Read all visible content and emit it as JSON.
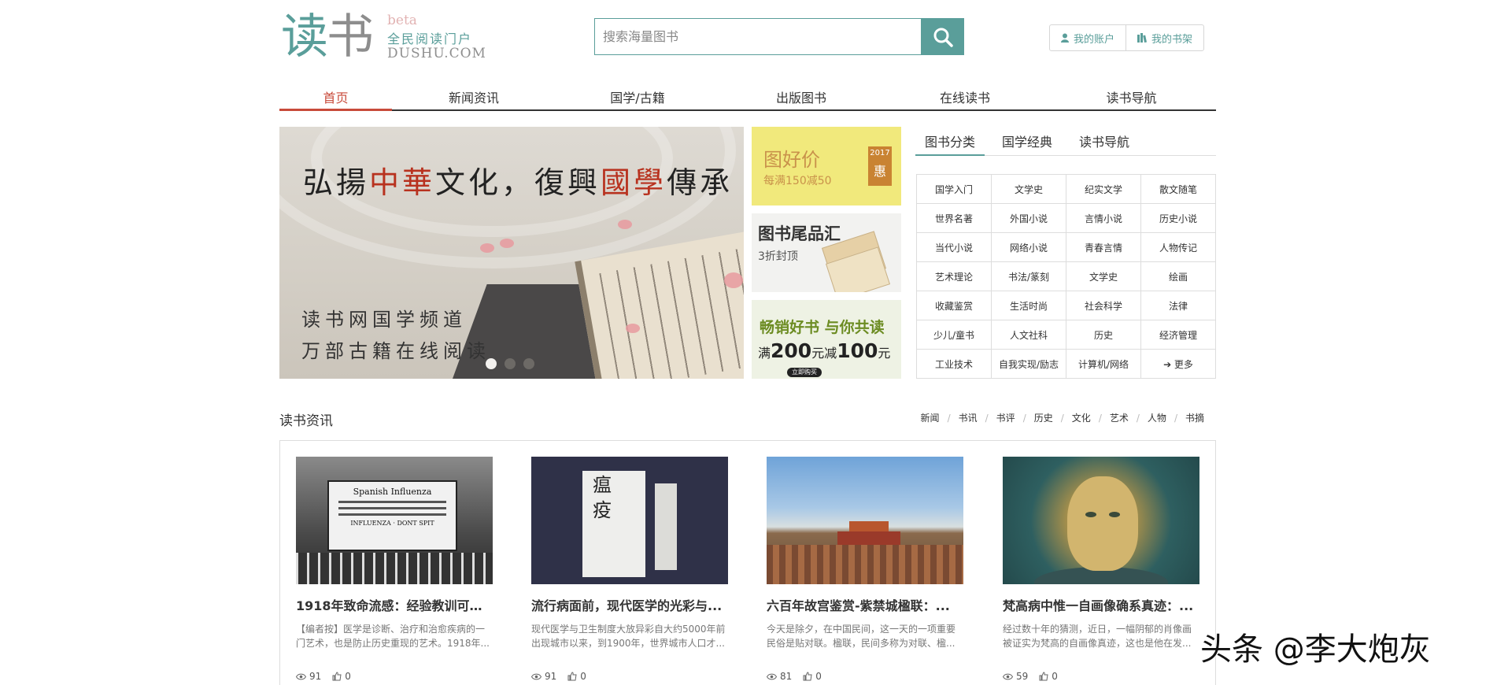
{
  "header": {
    "logo_cn_1": "读",
    "logo_cn_2": "书",
    "logo_beta": "beta",
    "logo_slogan": "全民阅读门户",
    "logo_en": "DUSHU.COM",
    "search_placeholder": "搜索海量图书",
    "account_label": "我的账户",
    "shelf_label": "我的书架"
  },
  "nav": {
    "items": [
      "首页",
      "新闻资讯",
      "国学/古籍",
      "出版图书",
      "在线读书",
      "读书导航"
    ],
    "active": "首页"
  },
  "banner": {
    "title_1": "弘揚",
    "title_2": "中華",
    "title_3": "文化，復興",
    "title_4": "國學",
    "title_5": "傳承",
    "sub_1": "读书网国学频道",
    "sub_2": "万部古籍在线阅读",
    "glyphs": "瘟疫"
  },
  "promos": {
    "p1_title": "图好价",
    "p1_sub": "每满150减50",
    "p1_year": "2017",
    "p1_tag": "惠",
    "p2_title": "图书尾品汇",
    "p2_sub": "3折封顶",
    "p3_title": "畅销好书 与你共读",
    "p3_sub_a": "满",
    "p3_sub_b": "200",
    "p3_sub_c": "元减",
    "p3_sub_d": "100",
    "p3_sub_e": "元",
    "p3_btn": "立即购买"
  },
  "category": {
    "tabs": [
      "图书分类",
      "国学经典",
      "读书导航"
    ],
    "active": "图书分类",
    "cells": [
      "国学入门",
      "文学史",
      "纪实文学",
      "散文随笔",
      "世界名著",
      "外国小说",
      "言情小说",
      "历史小说",
      "当代小说",
      "网络小说",
      "青春言情",
      "人物传记",
      "艺术理论",
      "书法/篆刻",
      "文学史",
      "绘画",
      "收藏鉴赏",
      "生活时尚",
      "社会科学",
      "法律",
      "少儿/童书",
      "人文社科",
      "历史",
      "经济管理",
      "工业技术",
      "自我实现/励志",
      "计算机/网络",
      "➔ 更多"
    ]
  },
  "news": {
    "section_title": "读书资讯",
    "links": [
      "新闻",
      "书讯",
      "书评",
      "历史",
      "文化",
      "艺术",
      "人物",
      "书摘"
    ],
    "cards": [
      {
        "title": "1918年致命流感：经验教训可以...",
        "desc": "【编者按】医学是诊断、治疗和治愈疾病的一门艺术，也是防止历史重现的艺术。1918年...",
        "views": "91",
        "likes": "0",
        "img_text_1": "Spanish Influenza",
        "img_text_2": "INFLUENZA · DONT SPIT"
      },
      {
        "title": "流行病面前，现代医学的光彩与...",
        "desc": "现代医学与卫生制度大放异彩自大约5000年前出现城市以来，到1900年，世界城市人口才...",
        "views": "91",
        "likes": "0"
      },
      {
        "title": "六百年故宫鉴赏-紫禁城楹联：...",
        "desc": "今天是除夕，在中国民间，这一天的一项重要民俗是贴对联。楹联，民间多称为对联、楹...",
        "views": "81",
        "likes": "0"
      },
      {
        "title": "梵高病中惟一自画像确系真迹：...",
        "desc": "经过数十年的猜测，近日，一幅阴郁的肖像画被证实为梵高的自画像真迹，这也是他在发...",
        "views": "59",
        "likes": "0"
      }
    ]
  },
  "watermark": "头条 @李大炮灰",
  "colors": {
    "accent": "#5a9e9a",
    "active_red": "#c84a3a"
  }
}
